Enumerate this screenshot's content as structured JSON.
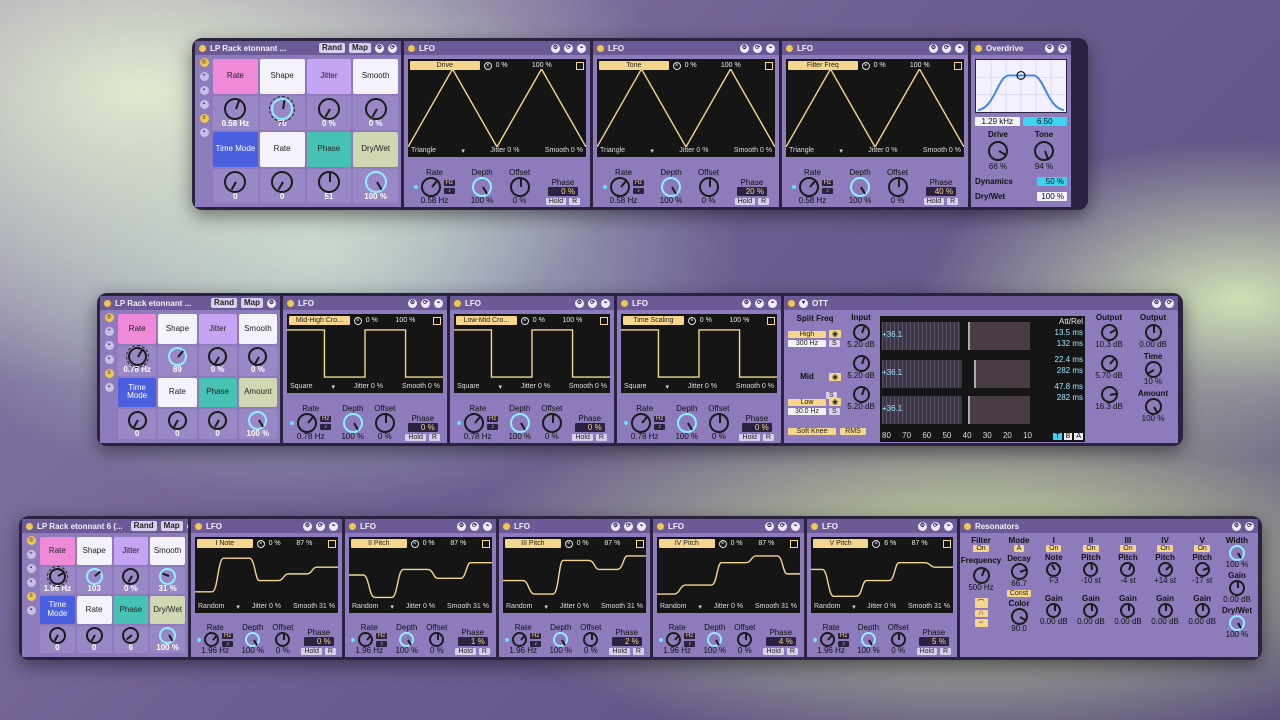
{
  "colors": {
    "rate": "#ef8ad8",
    "jitter": "#c6a4f4",
    "time_mode": "#4a5fe0",
    "phase": "#46c3b5",
    "white": "#f4f2fa",
    "amount": "#cfd8b3",
    "knob_ring": "#8ef0ff",
    "accent_yellow": "#f6d58c"
  },
  "rack1": {
    "macro": {
      "title": "LP Rack etonnant ...",
      "rand": "Rand",
      "map": "Map",
      "labels": [
        "Rate",
        "Shape",
        "Jitter",
        "Smooth",
        "Time Mode",
        "Rate",
        "Phase",
        "Dry/Wet"
      ],
      "values": [
        "0.58 Hz",
        "70",
        "0 %",
        "0 %",
        "0",
        "0",
        "51",
        "100 %"
      ]
    },
    "lfos": [
      {
        "title": "LFO",
        "target": "Drive",
        "offset_pct": "0 %",
        "depth_pct": "100 %",
        "shape": "Triangle",
        "jitter": "Jitter 0 %",
        "smooth": "Smooth 0 %",
        "rate": "0.58 Hz",
        "depth": "100 %",
        "offset": "0 %",
        "phase": "0 %",
        "hold": "Hold",
        "r": "R",
        "hz": "Hz",
        "labels": {
          "rate": "Rate",
          "depth": "Depth",
          "offset": "Offset",
          "phase": "Phase"
        }
      },
      {
        "title": "LFO",
        "target": "Tone",
        "offset_pct": "0 %",
        "depth_pct": "100 %",
        "shape": "Triangle",
        "jitter": "Jitter 0 %",
        "smooth": "Smooth 0 %",
        "rate": "0.58 Hz",
        "depth": "100 %",
        "offset": "0 %",
        "phase": "20 %",
        "hold": "Hold",
        "r": "R",
        "hz": "Hz",
        "labels": {
          "rate": "Rate",
          "depth": "Depth",
          "offset": "Offset",
          "phase": "Phase"
        }
      },
      {
        "title": "LFO",
        "target": "Filter Freq",
        "offset_pct": "0 %",
        "depth_pct": "100 %",
        "shape": "Triangle",
        "jitter": "Jitter 0 %",
        "smooth": "Smooth 0 %",
        "rate": "0.58 Hz",
        "depth": "100 %",
        "offset": "0 %",
        "phase": "40 %",
        "hold": "Hold",
        "r": "R",
        "hz": "Hz",
        "labels": {
          "rate": "Rate",
          "depth": "Depth",
          "offset": "Offset",
          "phase": "Phase"
        }
      }
    ],
    "overdrive": {
      "title": "Overdrive",
      "freq": "1.29 kHz",
      "bw": "6.50",
      "drive_label": "Drive",
      "drive": "66 %",
      "tone_label": "Tone",
      "tone": "94 %",
      "dynamics_label": "Dynamics",
      "dynamics": "50 %",
      "drywet_label": "Dry/Wet",
      "drywet": "100 %"
    }
  },
  "rack2": {
    "macro": {
      "title": "LP Rack etonnant ...",
      "rand": "Rand",
      "map": "Map",
      "labels": [
        "Rate",
        "Shape",
        "Jitter",
        "Smooth",
        "Time Mode",
        "Rate",
        "Phase",
        "Amount"
      ],
      "values": [
        "0.78 Hz",
        "89",
        "0 %",
        "0 %",
        "0",
        "0",
        "0",
        "100 %"
      ]
    },
    "lfos": [
      {
        "title": "LFO",
        "target": "Mid-High Cro...",
        "offset_pct": "0 %",
        "depth_pct": "100 %",
        "shape": "Square",
        "jitter": "Jitter 0 %",
        "smooth": "Smooth 0 %",
        "rate": "0.78 Hz",
        "depth": "100 %",
        "offset": "0 %",
        "phase": "0 %",
        "hold": "Hold",
        "r": "R",
        "hz": "Hz",
        "labels": {
          "rate": "Rate",
          "depth": "Depth",
          "offset": "Offset",
          "phase": "Phase"
        }
      },
      {
        "title": "LFO",
        "target": "Low-Mid Cro...",
        "offset_pct": "0 %",
        "depth_pct": "100 %",
        "shape": "Square",
        "jitter": "Jitter 0 %",
        "smooth": "Smooth 0 %",
        "rate": "0.78 Hz",
        "depth": "100 %",
        "offset": "0 %",
        "phase": "0 %",
        "hold": "Hold",
        "r": "R",
        "hz": "Hz",
        "labels": {
          "rate": "Rate",
          "depth": "Depth",
          "offset": "Offset",
          "phase": "Phase"
        }
      },
      {
        "title": "LFO",
        "target": "Time Scaling",
        "offset_pct": "0 %",
        "depth_pct": "100 %",
        "shape": "Square",
        "jitter": "Jitter 0 %",
        "smooth": "Smooth 0 %",
        "rate": "0.78 Hz",
        "depth": "100 %",
        "offset": "0 %",
        "phase": "0 %",
        "hold": "Hold",
        "r": "R",
        "hz": "Hz",
        "labels": {
          "rate": "Rate",
          "depth": "Depth",
          "offset": "Offset",
          "phase": "Phase"
        }
      }
    ],
    "ott": {
      "title": "OTT",
      "split": "Split Freq",
      "high": "High",
      "high_freq": "300 Hz",
      "mid": "Mid",
      "low": "Low",
      "low_freq": "30.0 Hz",
      "soft_knee": "Soft Knee",
      "rms": "RMS",
      "input_label": "Input",
      "inputs": [
        "5.20 dB",
        "5.20 dB",
        "5.20 dB"
      ],
      "meters": [
        "+36.1",
        "+36.1",
        "+36.1"
      ],
      "att_rel_label": "Att/Rel",
      "att_rel": [
        "13.5 ms",
        "132 ms",
        "22.4 ms",
        "282 ms",
        "47.8 ms",
        "282 ms"
      ],
      "scale": [
        "80",
        "70",
        "60",
        "50",
        "40",
        "30",
        "20",
        "10"
      ],
      "tba": [
        "T",
        "B",
        "A"
      ],
      "output_label": "Output",
      "outputs": [
        "10.3 dB",
        "5.70 dB",
        "16.3 dB"
      ],
      "output2_label": "Output",
      "output2": "0.00 dB",
      "time_label": "Time",
      "time": "10 %",
      "amount_label": "Amount",
      "amount": "100 %"
    }
  },
  "rack3": {
    "macro": {
      "title": "LP Rack etonnant 6 (...",
      "rand": "Rand",
      "map": "Map",
      "labels": [
        "Rate",
        "Shape",
        "Jitter",
        "Smooth",
        "Time Mode",
        "Rate",
        "Phase",
        "Dry/Wet"
      ],
      "values": [
        "1.96 Hz",
        "103",
        "0 %",
        "31 %",
        "0",
        "0",
        "6",
        "100 %"
      ]
    },
    "lfos": [
      {
        "title": "LFO",
        "target": "I Note",
        "offset_pct": "0 %",
        "depth_pct": "87 %",
        "shape": "Random",
        "jitter": "Jitter 0 %",
        "smooth": "Smooth 31 %",
        "rate": "1.96 Hz",
        "depth": "100 %",
        "offset": "0 %",
        "phase": "0 %",
        "hold": "Hold",
        "r": "R",
        "hz": "Hz",
        "labels": {
          "rate": "Rate",
          "depth": "Depth",
          "offset": "Offset",
          "phase": "Phase"
        }
      },
      {
        "title": "LFO",
        "target": "II Pitch",
        "offset_pct": "0 %",
        "depth_pct": "87 %",
        "shape": "Random",
        "jitter": "Jitter 0 %",
        "smooth": "Smooth 31 %",
        "rate": "1.96 Hz",
        "depth": "100 %",
        "offset": "0 %",
        "phase": "1 %",
        "hold": "Hold",
        "r": "R",
        "hz": "Hz",
        "labels": {
          "rate": "Rate",
          "depth": "Depth",
          "offset": "Offset",
          "phase": "Phase"
        }
      },
      {
        "title": "LFO",
        "target": "III Pitch",
        "offset_pct": "0 %",
        "depth_pct": "87 %",
        "shape": "Random",
        "jitter": "Jitter 0 %",
        "smooth": "Smooth 31 %",
        "rate": "1.96 Hz",
        "depth": "100 %",
        "offset": "0 %",
        "phase": "2 %",
        "hold": "Hold",
        "r": "R",
        "hz": "Hz",
        "labels": {
          "rate": "Rate",
          "depth": "Depth",
          "offset": "Offset",
          "phase": "Phase"
        }
      },
      {
        "title": "LFO",
        "target": "IV Pitch",
        "offset_pct": "0 %",
        "depth_pct": "87 %",
        "shape": "Random",
        "jitter": "Jitter 0 %",
        "smooth": "Smooth 31 %",
        "rate": "1.96 Hz",
        "depth": "100 %",
        "offset": "0 %",
        "phase": "4 %",
        "hold": "Hold",
        "r": "R",
        "hz": "Hz",
        "labels": {
          "rate": "Rate",
          "depth": "Depth",
          "offset": "Offset",
          "phase": "Phase"
        }
      },
      {
        "title": "LFO",
        "target": "V Pitch",
        "offset_pct": "6 %",
        "depth_pct": "87 %",
        "shape": "Random",
        "jitter": "Jitter 0 %",
        "smooth": "Smooth 31 %",
        "rate": "1.96 Hz",
        "depth": "100 %",
        "offset": "0 %",
        "phase": "5 %",
        "hold": "Hold",
        "r": "R",
        "hz": "Hz",
        "labels": {
          "rate": "Rate",
          "depth": "Depth",
          "offset": "Offset",
          "phase": "Phase"
        }
      }
    ],
    "resonators": {
      "title": "Resonators",
      "filter": "Filter",
      "on": "On",
      "frequency_label": "Frequency",
      "frequency": "500 Hz",
      "mode_label": "Mode",
      "mode": "A",
      "decay_label": "Decay",
      "decay": "66.7",
      "const": "Const",
      "color_label": "Color",
      "color": "90.0",
      "cols": [
        {
          "name": "I",
          "on": "On",
          "p_label": "Note",
          "p": "F3",
          "gain": "0.00 dB"
        },
        {
          "name": "II",
          "on": "On",
          "p_label": "Pitch",
          "p": "-10 st",
          "gain": "0.00 dB"
        },
        {
          "name": "III",
          "on": "On",
          "p_label": "Pitch",
          "p": "-4 st",
          "gain": "0.00 dB"
        },
        {
          "name": "IV",
          "on": "On",
          "p_label": "Pitch",
          "p": "+14 st",
          "gain": "0.00 dB"
        },
        {
          "name": "V",
          "on": "On",
          "p_label": "Pitch",
          "p": "-17 st",
          "gain": "0.00 dB"
        }
      ],
      "gain_label": "Gain",
      "width_label": "Width",
      "width": "100 %",
      "gain2_label": "Gain",
      "gain2": "0.00 dB",
      "drywet_label": "Dry/Wet",
      "drywet": "100 %"
    }
  }
}
